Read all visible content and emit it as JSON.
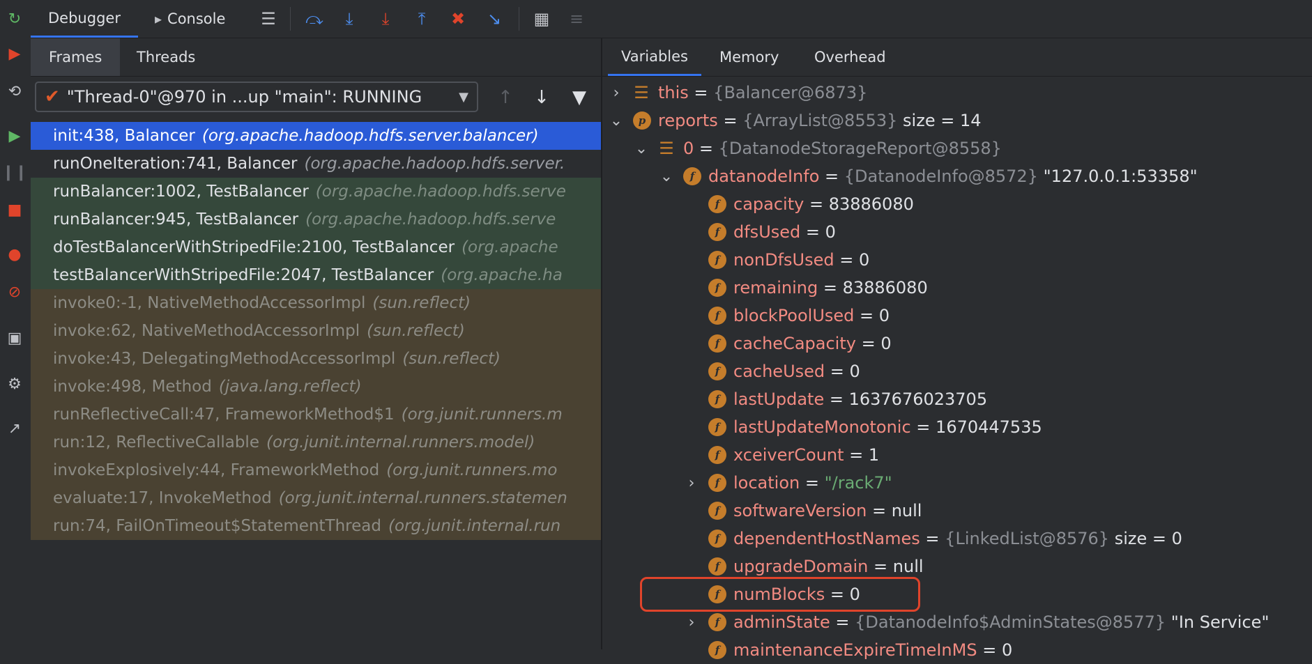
{
  "toolbar": {
    "debugger_tab": "Debugger",
    "console_tab": "Console"
  },
  "left_tabs": {
    "frames": "Frames",
    "threads": "Threads"
  },
  "thread_selector": {
    "value": "\"Thread-0\"@970 in ...up \"main\": RUNNING"
  },
  "frames": [
    {
      "method": "init:438, Balancer",
      "cls": "(org.apache.hadoop.hdfs.server.balancer)",
      "kind": "sel"
    },
    {
      "method": "runOneIteration:741, Balancer",
      "cls": "(org.apache.hadoop.hdfs.server.",
      "kind": "plain"
    },
    {
      "method": "runBalancer:1002, TestBalancer",
      "cls": "(org.apache.hadoop.hdfs.serve",
      "kind": "green"
    },
    {
      "method": "runBalancer:945, TestBalancer",
      "cls": "(org.apache.hadoop.hdfs.serve",
      "kind": "green"
    },
    {
      "method": "doTestBalancerWithStripedFile:2100, TestBalancer",
      "cls": "(org.apache",
      "kind": "green"
    },
    {
      "method": "testBalancerWithStripedFile:2047, TestBalancer",
      "cls": "(org.apache.ha",
      "kind": "green"
    },
    {
      "method": "invoke0:-1, NativeMethodAccessorImpl",
      "cls": "(sun.reflect)",
      "kind": "lib"
    },
    {
      "method": "invoke:62, NativeMethodAccessorImpl",
      "cls": "(sun.reflect)",
      "kind": "lib"
    },
    {
      "method": "invoke:43, DelegatingMethodAccessorImpl",
      "cls": "(sun.reflect)",
      "kind": "lib"
    },
    {
      "method": "invoke:498, Method",
      "cls": "(java.lang.reflect)",
      "kind": "lib"
    },
    {
      "method": "runReflectiveCall:47, FrameworkMethod$1",
      "cls": "(org.junit.runners.m",
      "kind": "lib"
    },
    {
      "method": "run:12, ReflectiveCallable",
      "cls": "(org.junit.internal.runners.model)",
      "kind": "lib"
    },
    {
      "method": "invokeExplosively:44, FrameworkMethod",
      "cls": "(org.junit.runners.mo",
      "kind": "lib"
    },
    {
      "method": "evaluate:17, InvokeMethod",
      "cls": "(org.junit.internal.runners.statemen",
      "kind": "lib"
    },
    {
      "method": "run:74, FailOnTimeout$StatementThread",
      "cls": "(org.junit.internal.run",
      "kind": "lib"
    }
  ],
  "right_tabs": {
    "variables": "Variables",
    "memory": "Memory",
    "overhead": "Overhead"
  },
  "variables": [
    {
      "depth": 0,
      "expand": "right",
      "icon": "list",
      "name": "this",
      "ref": "{Balancer@6873}",
      "extra": ""
    },
    {
      "depth": 0,
      "expand": "down",
      "icon": "p",
      "name": "reports",
      "ref": "{ArrayList@8553}",
      "extra": "size = 14"
    },
    {
      "depth": 1,
      "expand": "down",
      "icon": "list",
      "name": "0",
      "ref": "{DatanodeStorageReport@8558}",
      "extra": ""
    },
    {
      "depth": 2,
      "expand": "down",
      "icon": "f",
      "name": "datanodeInfo",
      "ref": "{DatanodeInfo@8572}",
      "extra": "\"127.0.0.1:53358\""
    },
    {
      "depth": 3,
      "expand": "",
      "icon": "f",
      "name": "capacity",
      "val": "83886080"
    },
    {
      "depth": 3,
      "expand": "",
      "icon": "f",
      "name": "dfsUsed",
      "val": "0"
    },
    {
      "depth": 3,
      "expand": "",
      "icon": "f",
      "name": "nonDfsUsed",
      "val": "0"
    },
    {
      "depth": 3,
      "expand": "",
      "icon": "f",
      "name": "remaining",
      "val": "83886080"
    },
    {
      "depth": 3,
      "expand": "",
      "icon": "f",
      "name": "blockPoolUsed",
      "val": "0"
    },
    {
      "depth": 3,
      "expand": "",
      "icon": "f",
      "name": "cacheCapacity",
      "val": "0"
    },
    {
      "depth": 3,
      "expand": "",
      "icon": "f",
      "name": "cacheUsed",
      "val": "0"
    },
    {
      "depth": 3,
      "expand": "",
      "icon": "f",
      "name": "lastUpdate",
      "val": "1637676023705"
    },
    {
      "depth": 3,
      "expand": "",
      "icon": "f",
      "name": "lastUpdateMonotonic",
      "val": "1670447535"
    },
    {
      "depth": 3,
      "expand": "",
      "icon": "f",
      "name": "xceiverCount",
      "val": "1"
    },
    {
      "depth": 3,
      "expand": "right",
      "icon": "f",
      "name": "location",
      "str": "\"/rack7\""
    },
    {
      "depth": 3,
      "expand": "",
      "icon": "f",
      "name": "softwareVersion",
      "val": "null"
    },
    {
      "depth": 3,
      "expand": "",
      "icon": "f",
      "name": "dependentHostNames",
      "ref": "{LinkedList@8576}",
      "extra": "size = 0"
    },
    {
      "depth": 3,
      "expand": "",
      "icon": "f",
      "name": "upgradeDomain",
      "val": "null"
    },
    {
      "depth": 3,
      "expand": "",
      "icon": "f",
      "name": "numBlocks",
      "val": "0"
    },
    {
      "depth": 3,
      "expand": "right",
      "icon": "f",
      "name": "adminState",
      "ref": "{DatanodeInfo$AdminStates@8577}",
      "extra": "\"In Service\""
    },
    {
      "depth": 3,
      "expand": "",
      "icon": "f",
      "name": "maintenanceExpireTimeInMS",
      "val": "0"
    }
  ]
}
